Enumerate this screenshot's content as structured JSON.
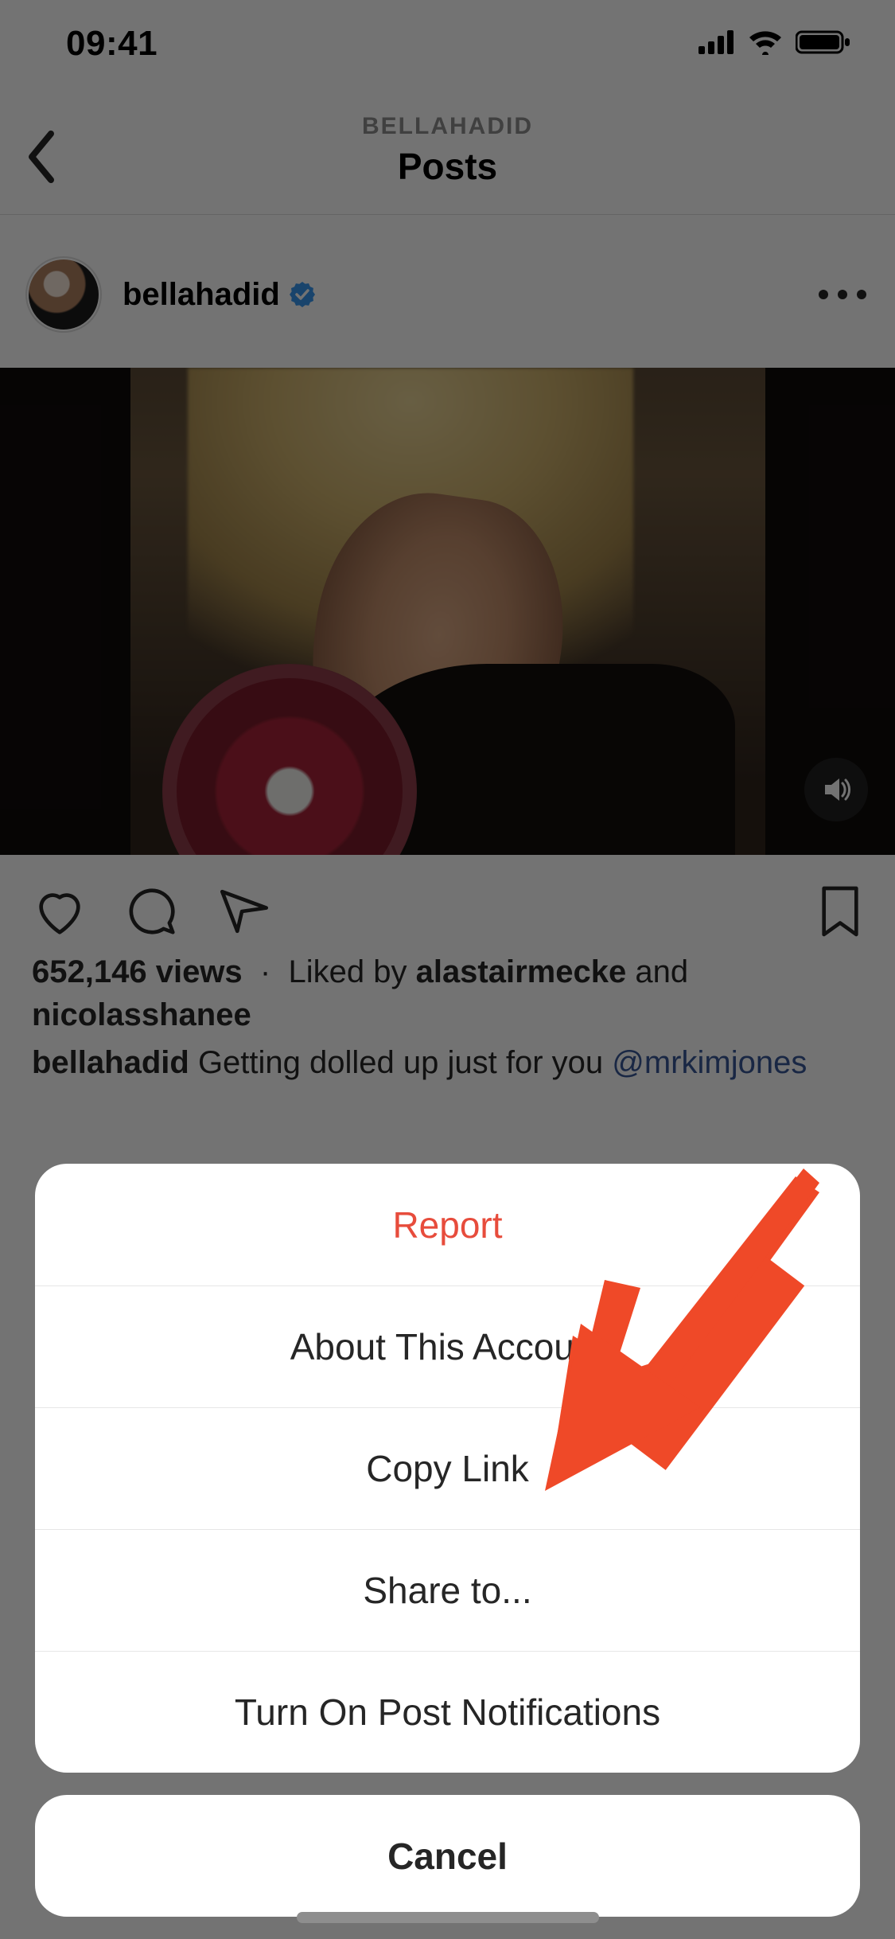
{
  "statusbar": {
    "time": "09:41"
  },
  "header": {
    "subtitle": "BELLAHADID",
    "title": "Posts"
  },
  "post": {
    "username": "bellahadid",
    "views_count": "652,146 views",
    "liked_prefix": "Liked by",
    "liked_user1": "alastairmecke",
    "liked_and": "and",
    "liked_user2": "nicolasshanee",
    "caption_user": "bellahadid",
    "caption_text": "Getting dolled up just for you ",
    "caption_mention": "@mrkimjones"
  },
  "sheet": {
    "items": [
      "Report",
      "About This Account",
      "Copy Link",
      "Share to...",
      "Turn On Post Notifications"
    ],
    "cancel": "Cancel"
  },
  "colors": {
    "report": "#e74c3c",
    "arrow": "#ef4928"
  }
}
